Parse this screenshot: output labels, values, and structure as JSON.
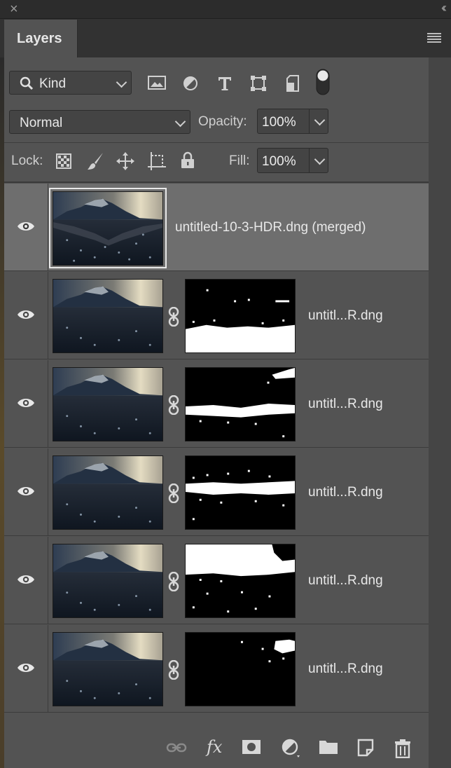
{
  "panel": {
    "tab_label": "Layers",
    "close_glyph": "×",
    "collapse_glyph": "‹‹"
  },
  "filter": {
    "kind_label": "Kind",
    "icons": [
      "image-filter-icon",
      "adjustment-filter-icon",
      "type-filter-icon",
      "shape-filter-icon",
      "smart-object-filter-icon",
      "filter-toggle-icon"
    ]
  },
  "blend": {
    "mode": "Normal",
    "opacity_label": "Opacity:",
    "opacity_value": "100%"
  },
  "lock": {
    "label": "Lock:",
    "fill_label": "Fill:",
    "fill_value": "100%"
  },
  "layers": [
    {
      "name": "untitled-10-3-HDR.dng (merged)",
      "selected": true,
      "has_mask": false
    },
    {
      "name": "untitl...R.dng",
      "selected": false,
      "has_mask": true
    },
    {
      "name": "untitl...R.dng",
      "selected": false,
      "has_mask": true
    },
    {
      "name": "untitl...R.dng",
      "selected": false,
      "has_mask": true
    },
    {
      "name": "untitl...R.dng",
      "selected": false,
      "has_mask": true
    },
    {
      "name": "untitl...R.dng",
      "selected": false,
      "has_mask": true
    }
  ],
  "bottom_bar": {
    "icons": [
      "link-layers-icon",
      "fx-icon",
      "add-mask-icon",
      "new-adjustment-icon",
      "new-group-icon",
      "new-layer-icon",
      "delete-layer-icon"
    ],
    "fx_label": "fx"
  },
  "colors": {
    "panel_bg": "#535353",
    "selected_row": "#6e6e6e",
    "dark_chrome": "#323232"
  }
}
